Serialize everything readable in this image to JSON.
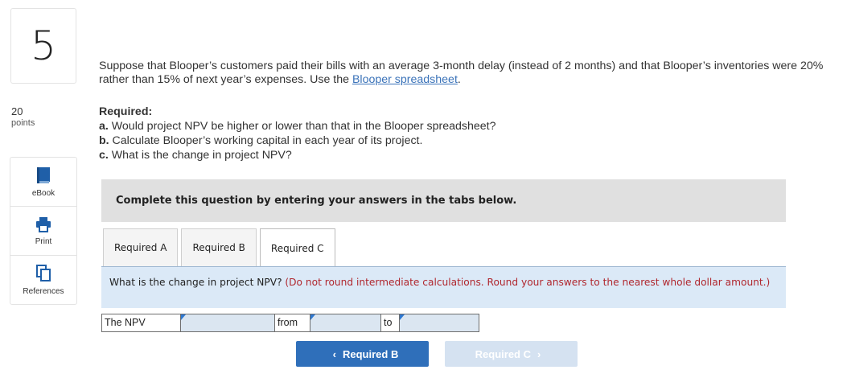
{
  "question_number": "5",
  "points": {
    "value": "20",
    "label": "points"
  },
  "tools": [
    {
      "label": "eBook",
      "icon": "book-icon"
    },
    {
      "label": "Print",
      "icon": "printer-icon"
    },
    {
      "label": "References",
      "icon": "documents-icon"
    }
  ],
  "question": {
    "text_before": "Suppose that Blooper’s customers paid their bills with an average 3-month delay (instead of 2 months) and that Blooper’s inventories were 20% rather than 15% of next year’s expenses. Use the ",
    "link": "Blooper spreadsheet",
    "text_after": "."
  },
  "required": {
    "heading": "Required:",
    "items": [
      {
        "prefix": "a.",
        "text": " Would project NPV be higher or lower than that in the Blooper spreadsheet?"
      },
      {
        "prefix": "b.",
        "text": " Calculate Blooper’s working capital in each year of its project."
      },
      {
        "prefix": "c.",
        "text": " What is the change in project NPV?"
      }
    ]
  },
  "banner": "Complete this question by entering your answers in the tabs below.",
  "tabs": [
    {
      "label": "Required A",
      "active": false
    },
    {
      "label": "Required B",
      "active": false
    },
    {
      "label": "Required C",
      "active": true
    }
  ],
  "content": {
    "question": "What is the change in project NPV?",
    "instruction": "(Do not round intermediate calculations. Round your answers to the nearest whole dollar amount.)"
  },
  "answer_row": {
    "label": "The NPV",
    "input1_value": "",
    "from_label": "from",
    "input2_value": "",
    "to_label": "to",
    "input3_value": ""
  },
  "nav": {
    "prev_label": "Required B",
    "next_label": "Required C"
  },
  "colors": {
    "primary": "#2f6fba",
    "disabled": "#d5e2f1",
    "instruction": "#b0272e",
    "input_bg": "#dbe6f1"
  }
}
